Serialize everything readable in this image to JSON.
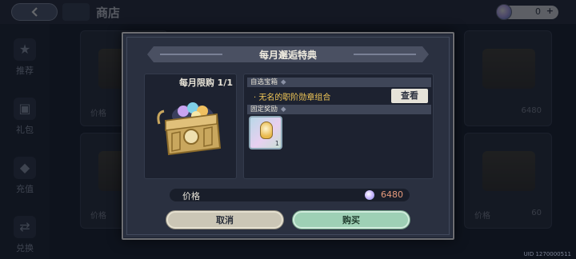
{
  "header": {
    "title": "商店",
    "currency_amount": "0",
    "currency_plus": "+"
  },
  "sidebar": {
    "items": [
      {
        "label": "推荐",
        "icon": "star-icon"
      },
      {
        "label": "礼包",
        "icon": "gift-icon"
      },
      {
        "label": "充值",
        "icon": "diamond-icon"
      },
      {
        "label": "兑换",
        "icon": "exchange-icon"
      }
    ]
  },
  "background_cards": [
    {
      "price_label": "价格",
      "price_value": ""
    },
    {
      "price_label": "",
      "price_value": "6480"
    },
    {
      "price_label": "价格",
      "price_value": ""
    },
    {
      "price_label": "价格",
      "price_value": "60"
    }
  ],
  "uid": "UID 1270000511",
  "modal": {
    "title": "每月邂逅特典",
    "limit": "每月限购 1/1",
    "selectable_box": {
      "header": "自选宝箱",
      "item": "· 无名的职阶勋章组合",
      "view_button": "查看"
    },
    "fixed_rewards": {
      "header": "固定奖励",
      "item_qty": "1"
    },
    "price": {
      "label": "价格",
      "value": "6480"
    },
    "cancel_button": "取消",
    "buy_button": "购买"
  },
  "colors": {
    "accent_gold": "#f2c857",
    "price": "#e59a7c",
    "buy": "#9ed0b5",
    "cancel": "#cbc6b6"
  }
}
